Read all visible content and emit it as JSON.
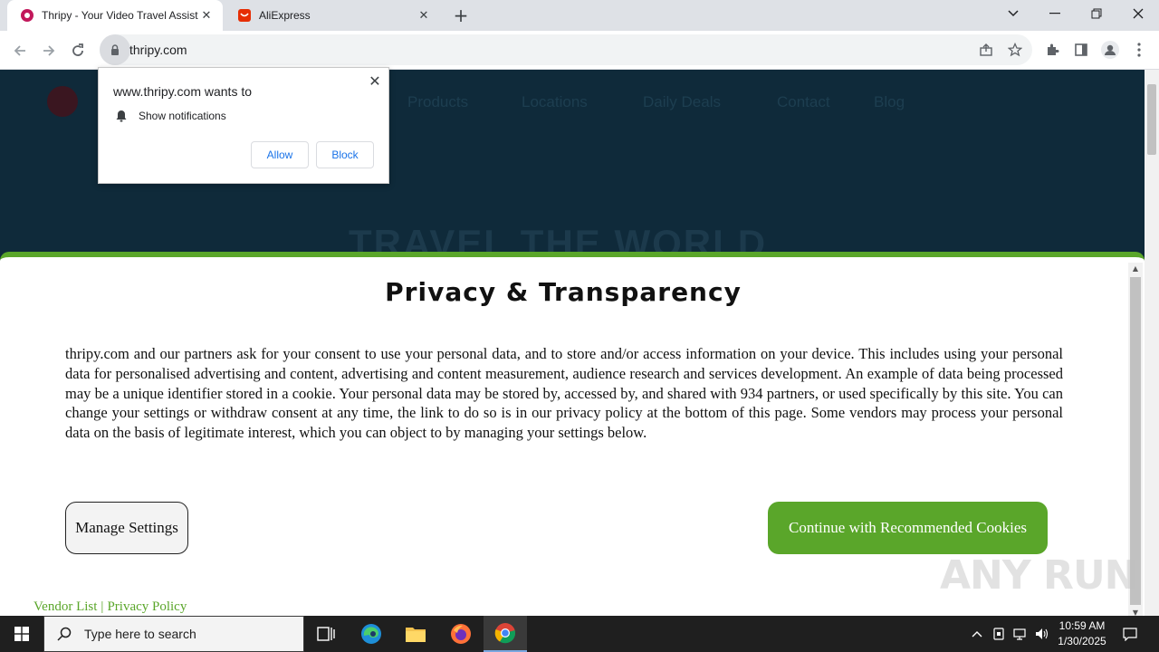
{
  "browser": {
    "tabs": [
      {
        "title": "Thripy - Your Video Travel Assist",
        "active": true
      },
      {
        "title": "AliExpress",
        "active": false
      }
    ],
    "url": "thripy.com"
  },
  "site": {
    "nav": [
      "Products",
      "Locations",
      "Daily Deals",
      "Contact",
      "Blog"
    ],
    "hero": "TRAVEL THE WORLD"
  },
  "notification": {
    "heading": "www.thripy.com wants to",
    "permission": "Show notifications",
    "allow": "Allow",
    "block": "Block"
  },
  "consent": {
    "title": "Privacy & Transparency",
    "body": "thripy.com and our partners ask for your consent to use your personal data, and to store and/or access information on your device. This includes using your personal data for personalised advertising and content, advertising and content measurement, audience research and services development. An example of data being processed may be a unique identifier stored in a cookie. Your personal data may be stored by, accessed by, and shared with 934 partners, or used specifically by this site. You can change your settings or withdraw consent at any time, the link to do so is in our privacy policy at the bottom of this page. Some vendors may process your personal data on the basis of legitimate interest, which you can object to by managing your settings below.",
    "manage": "Manage Settings",
    "continue": "Continue with Recommended Cookies",
    "vendor_link": "Vendor List",
    "separator": "|",
    "privacy_link": "Privacy Policy",
    "accent": "#5aa62a"
  },
  "watermark": "ANY RUN",
  "taskbar": {
    "search_placeholder": "Type here to search",
    "time": "10:59 AM",
    "date": "1/30/2025"
  }
}
